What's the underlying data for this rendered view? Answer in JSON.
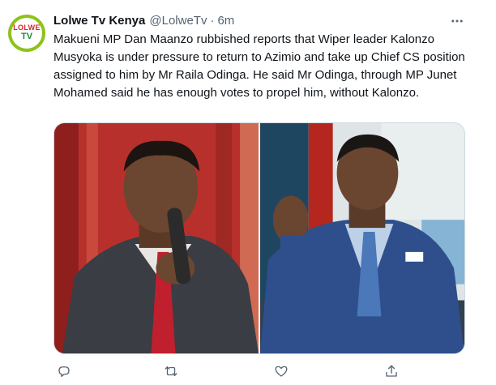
{
  "tweet": {
    "display_name": "Lolwe Tv Kenya",
    "handle": "@LolweTv",
    "separator": "·",
    "time": "6m",
    "text": "Makueni MP Dan Maanzo rubbished reports that Wiper leader Kalonzo Musyoka is under pressure to return to Azimio and take up Chief CS position assigned to him by Mr Raila Odinga. He said Mr Odinga, through MP Junet Mohamed said he has enough votes to propel him, without Kalonzo.",
    "avatar": {
      "logo_top": "LOLWE",
      "logo_bottom": "TV"
    }
  },
  "icons": {
    "more": "more-horizontal-icon",
    "reply": "reply-icon",
    "retweet": "retweet-icon",
    "like": "like-heart-icon",
    "share": "share-icon"
  },
  "colors": {
    "text": "#0f1419",
    "secondary": "#536471",
    "border": "#cfd9de",
    "avatar_ring": "#8fc21b"
  }
}
